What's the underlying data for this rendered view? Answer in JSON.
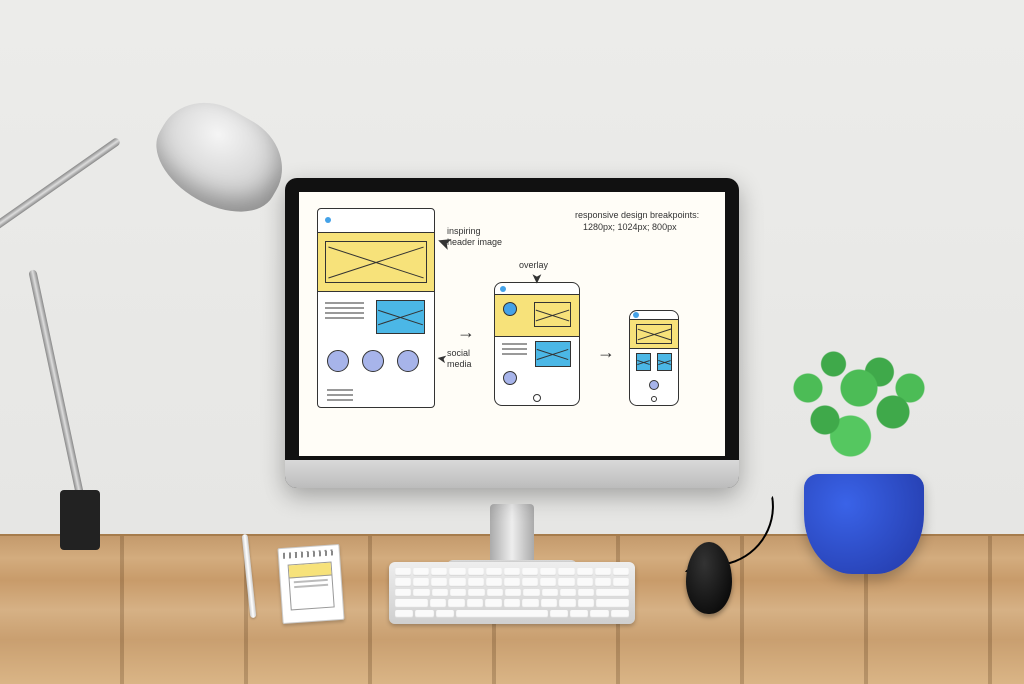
{
  "screen": {
    "annotations": {
      "header_image": "inspiring\nheader image",
      "overlay": "overlay",
      "social_media": "social\nmedia",
      "breakpoints_title": "responsive design breakpoints:",
      "breakpoints_values": "1280px; 1024px; 800px"
    }
  }
}
